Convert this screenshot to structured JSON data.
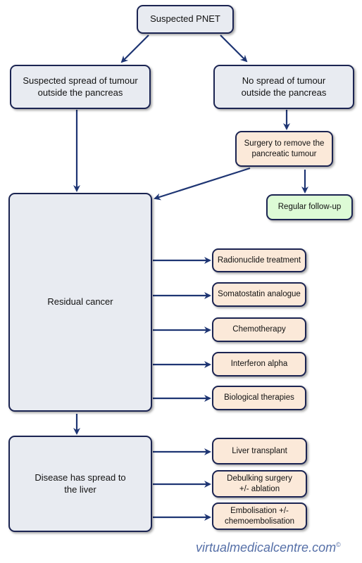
{
  "colors": {
    "arrow": "#1e3573",
    "border": "#1b2452",
    "neutral_fill": "#e8ebf1",
    "treatment_fill": "#fbe9d9",
    "outcome_fill": "#ddfbd6"
  },
  "nodes": {
    "root": "Suspected PNET",
    "spread": "Suspected spread of tumour outside the pancreas",
    "no_spread": "No spread of tumour outside the pancreas",
    "surgery": "Surgery to remove the pancreatic tumour",
    "follow_up": "Regular follow-up",
    "residual": "Residual cancer",
    "liver": "Disease has spread to the liver"
  },
  "residual_treatments": [
    "Radionuclide treatment",
    "Somatostatin analogue",
    "Chemotherapy",
    "Interferon alpha",
    "Biological therapies"
  ],
  "liver_treatments": [
    "Liver transplant",
    "Debulking surgery +/- ablation",
    "Embolisation +/- chemoembolisation"
  ],
  "logo": {
    "text": "virtualmedicalcentre.com",
    "mark": "©"
  }
}
